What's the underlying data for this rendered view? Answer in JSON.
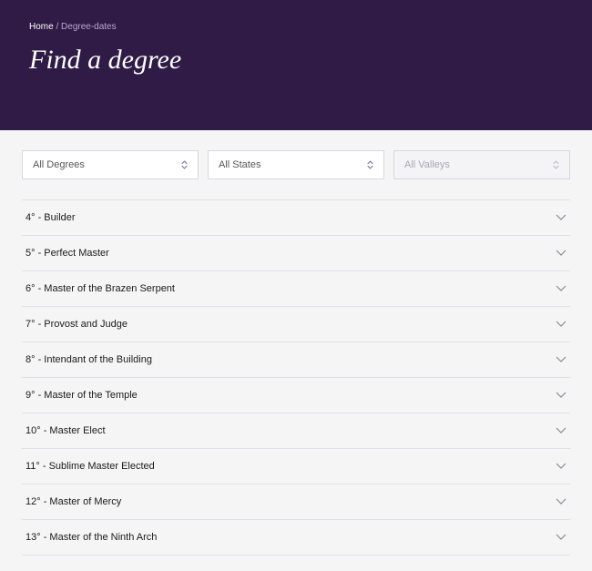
{
  "breadcrumb": {
    "home": "Home",
    "separator": "/",
    "current": "Degree-dates"
  },
  "page_title": "Find a degree",
  "filters": {
    "degrees": {
      "label": "All Degrees"
    },
    "states": {
      "label": "All States"
    },
    "valleys": {
      "label": "All Valleys"
    }
  },
  "degrees": [
    {
      "label": "4° - Builder"
    },
    {
      "label": "5° - Perfect Master"
    },
    {
      "label": "6° - Master of the Brazen Serpent"
    },
    {
      "label": "7° - Provost and Judge"
    },
    {
      "label": "8° - Intendant of the Building"
    },
    {
      "label": "9° - Master of the Temple"
    },
    {
      "label": "10° - Master Elect"
    },
    {
      "label": "11° - Sublime Master Elected"
    },
    {
      "label": "12° - Master of Mercy"
    },
    {
      "label": "13° - Master of the Ninth Arch"
    }
  ]
}
